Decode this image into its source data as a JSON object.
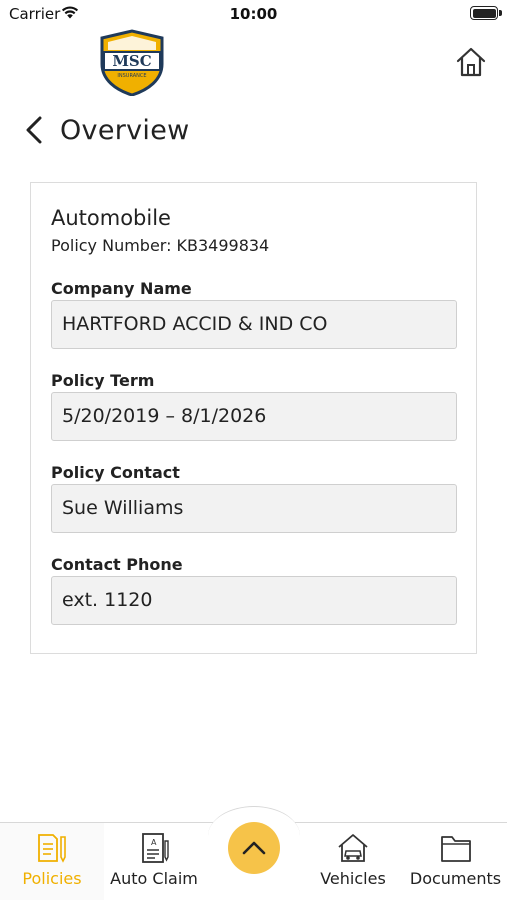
{
  "status_bar": {
    "carrier": "Carrier",
    "time": "10:00"
  },
  "header": {
    "logo_text": "MSC",
    "logo_subtext": "INSURANCE",
    "brand_color": "#f0b000",
    "brand_dark": "#1f3a5a"
  },
  "page": {
    "title": "Overview"
  },
  "policy": {
    "type": "Automobile",
    "number_label": "Policy Number:",
    "number": "KB3499834",
    "fields": [
      {
        "label": "Company Name",
        "value": "HARTFORD ACCID & IND CO"
      },
      {
        "label": "Policy Term",
        "value": "5/20/2019 – 8/1/2026"
      },
      {
        "label": "Policy Contact",
        "value": "Sue Williams"
      },
      {
        "label": "Contact Phone",
        "value": "ext. 1120"
      }
    ]
  },
  "tab_bar": {
    "tabs": [
      {
        "label": "Policies",
        "icon": "policies-icon",
        "active": true
      },
      {
        "label": "Auto Claim",
        "icon": "auto-claim-icon",
        "active": false
      },
      {
        "label": "Vehicles",
        "icon": "vehicles-icon",
        "active": false
      },
      {
        "label": "Documents",
        "icon": "documents-icon",
        "active": false
      }
    ],
    "fab_icon": "chevron-up-icon",
    "accent_color": "#f6c349"
  }
}
